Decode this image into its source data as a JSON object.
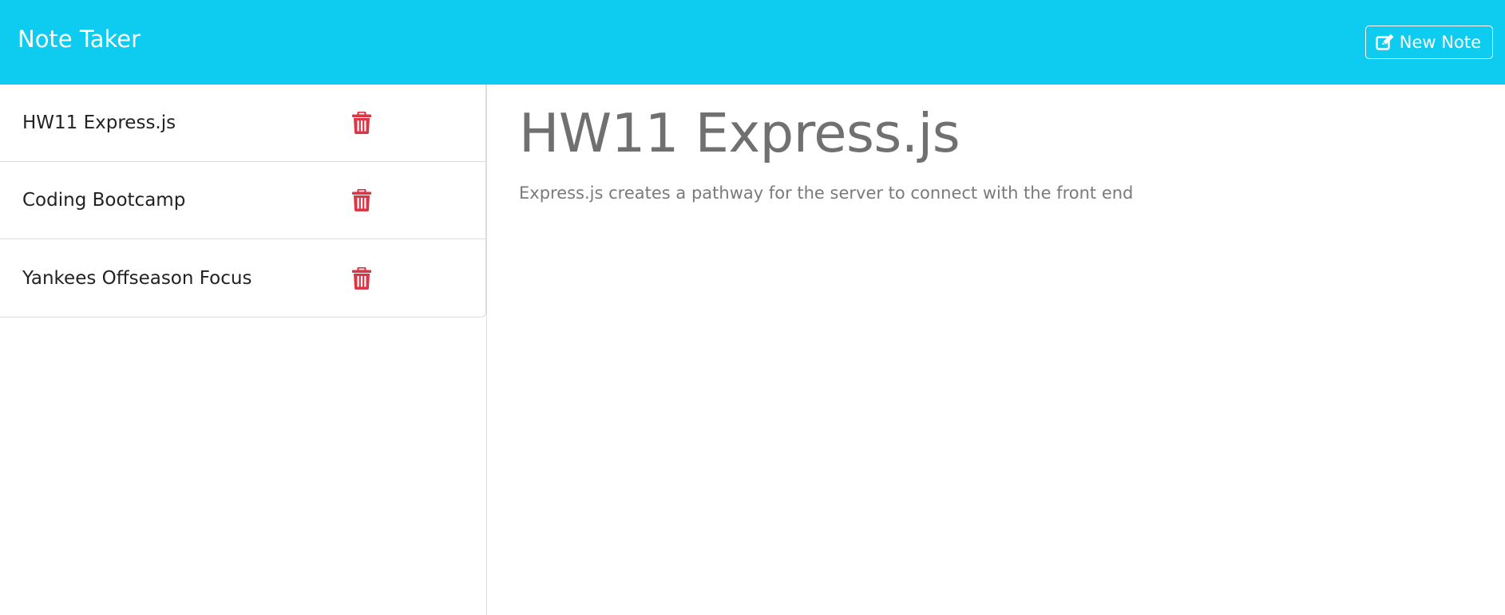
{
  "app": {
    "title": "Note Taker",
    "new_note_label": "New Note",
    "accent_color": "#0ecbf0",
    "delete_color": "#dc3545"
  },
  "sidebar": {
    "notes": [
      {
        "title": "HW11 Express.js",
        "icon": "trash-icon"
      },
      {
        "title": "Coding Bootcamp",
        "icon": "trash-icon"
      },
      {
        "title": "Yankees Offseason Focus",
        "icon": "trash-icon"
      }
    ]
  },
  "main": {
    "note_title": "HW11 Express.js",
    "note_text": "Express.js creates a pathway for the server to connect with the front end"
  }
}
